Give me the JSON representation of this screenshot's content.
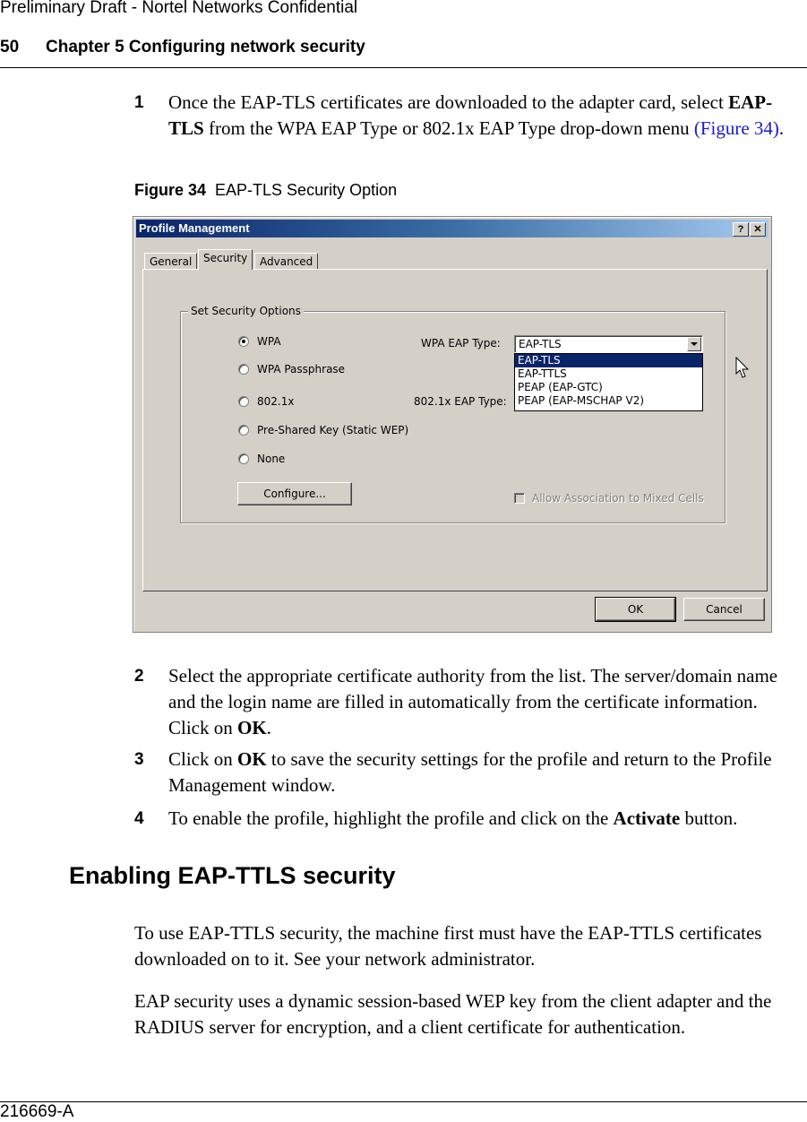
{
  "header": {
    "confidential": "Preliminary Draft - Nortel Networks Confidential",
    "page_number": "50",
    "chapter_title": "Chapter 5 Configuring network security"
  },
  "steps": [
    {
      "num": "1",
      "pre": "Once the EAP-TLS certificates are downloaded to the adapter card, select ",
      "bold": "EAP-TLS",
      "post": " from the WPA EAP Type or 802.1x EAP Type drop-down menu ",
      "link": "(Figure 34)",
      "end": "."
    },
    {
      "num": "2",
      "pre": "Select the appropriate certificate authority from the list. The server/domain name and the login name are filled in automatically from the certificate information. Click on ",
      "bold": "OK",
      "post": "."
    },
    {
      "num": "3",
      "pre": "Click on ",
      "bold": "OK",
      "post": " to save the security settings for the profile and return to the Profile Management window."
    },
    {
      "num": "4",
      "pre": "To enable the profile, highlight the profile and click on the ",
      "bold": "Activate",
      "post": " button."
    }
  ],
  "figure": {
    "label": "Figure 34",
    "caption": "EAP-TLS Security Option"
  },
  "dialog": {
    "title": "Profile Management",
    "help_button": "?",
    "close_button": "✕",
    "tabs": [
      {
        "label": "General",
        "active": false
      },
      {
        "label": "Security",
        "active": true
      },
      {
        "label": "Advanced",
        "active": false
      }
    ],
    "group_label": "Set Security Options",
    "radios": [
      {
        "label": "WPA",
        "checked": true
      },
      {
        "label": "WPA Passphrase",
        "checked": false
      },
      {
        "label": "802.1x",
        "checked": false
      },
      {
        "label": "Pre-Shared Key (Static WEP)",
        "checked": false
      },
      {
        "label": "None",
        "checked": false
      }
    ],
    "wpa_eap_label": "WPA EAP Type:",
    "wpa_eap_value": "EAP-TLS",
    "dot1x_eap_label": "802.1x EAP Type:",
    "dropdown_options": [
      {
        "label": "EAP-TLS",
        "selected": true
      },
      {
        "label": "EAP-TTLS",
        "selected": false
      },
      {
        "label": "PEAP (EAP-GTC)",
        "selected": false
      },
      {
        "label": "PEAP (EAP-MSCHAP V2)",
        "selected": false
      }
    ],
    "configure_button": "Configure...",
    "mixed_cells_checkbox": {
      "label": "Allow Association to Mixed Cells",
      "checked": false,
      "enabled": false
    },
    "ok_button": "OK",
    "cancel_button": "Cancel",
    "colors": {
      "titlebar_start": "#0a246a",
      "titlebar_end": "#a6caf0",
      "face": "#d4d0c8",
      "selection": "#0a246a"
    }
  },
  "section": {
    "heading": "Enabling EAP-TTLS security",
    "paragraphs": [
      "To use EAP-TTLS security, the machine first must have the EAP-TTLS certificates downloaded on to it. See your network administrator.",
      "EAP security uses a dynamic session-based WEP key from the client adapter and the RADIUS server for encryption, and a client certificate for authentication."
    ]
  },
  "footer": {
    "doc_number": "216669-A"
  }
}
